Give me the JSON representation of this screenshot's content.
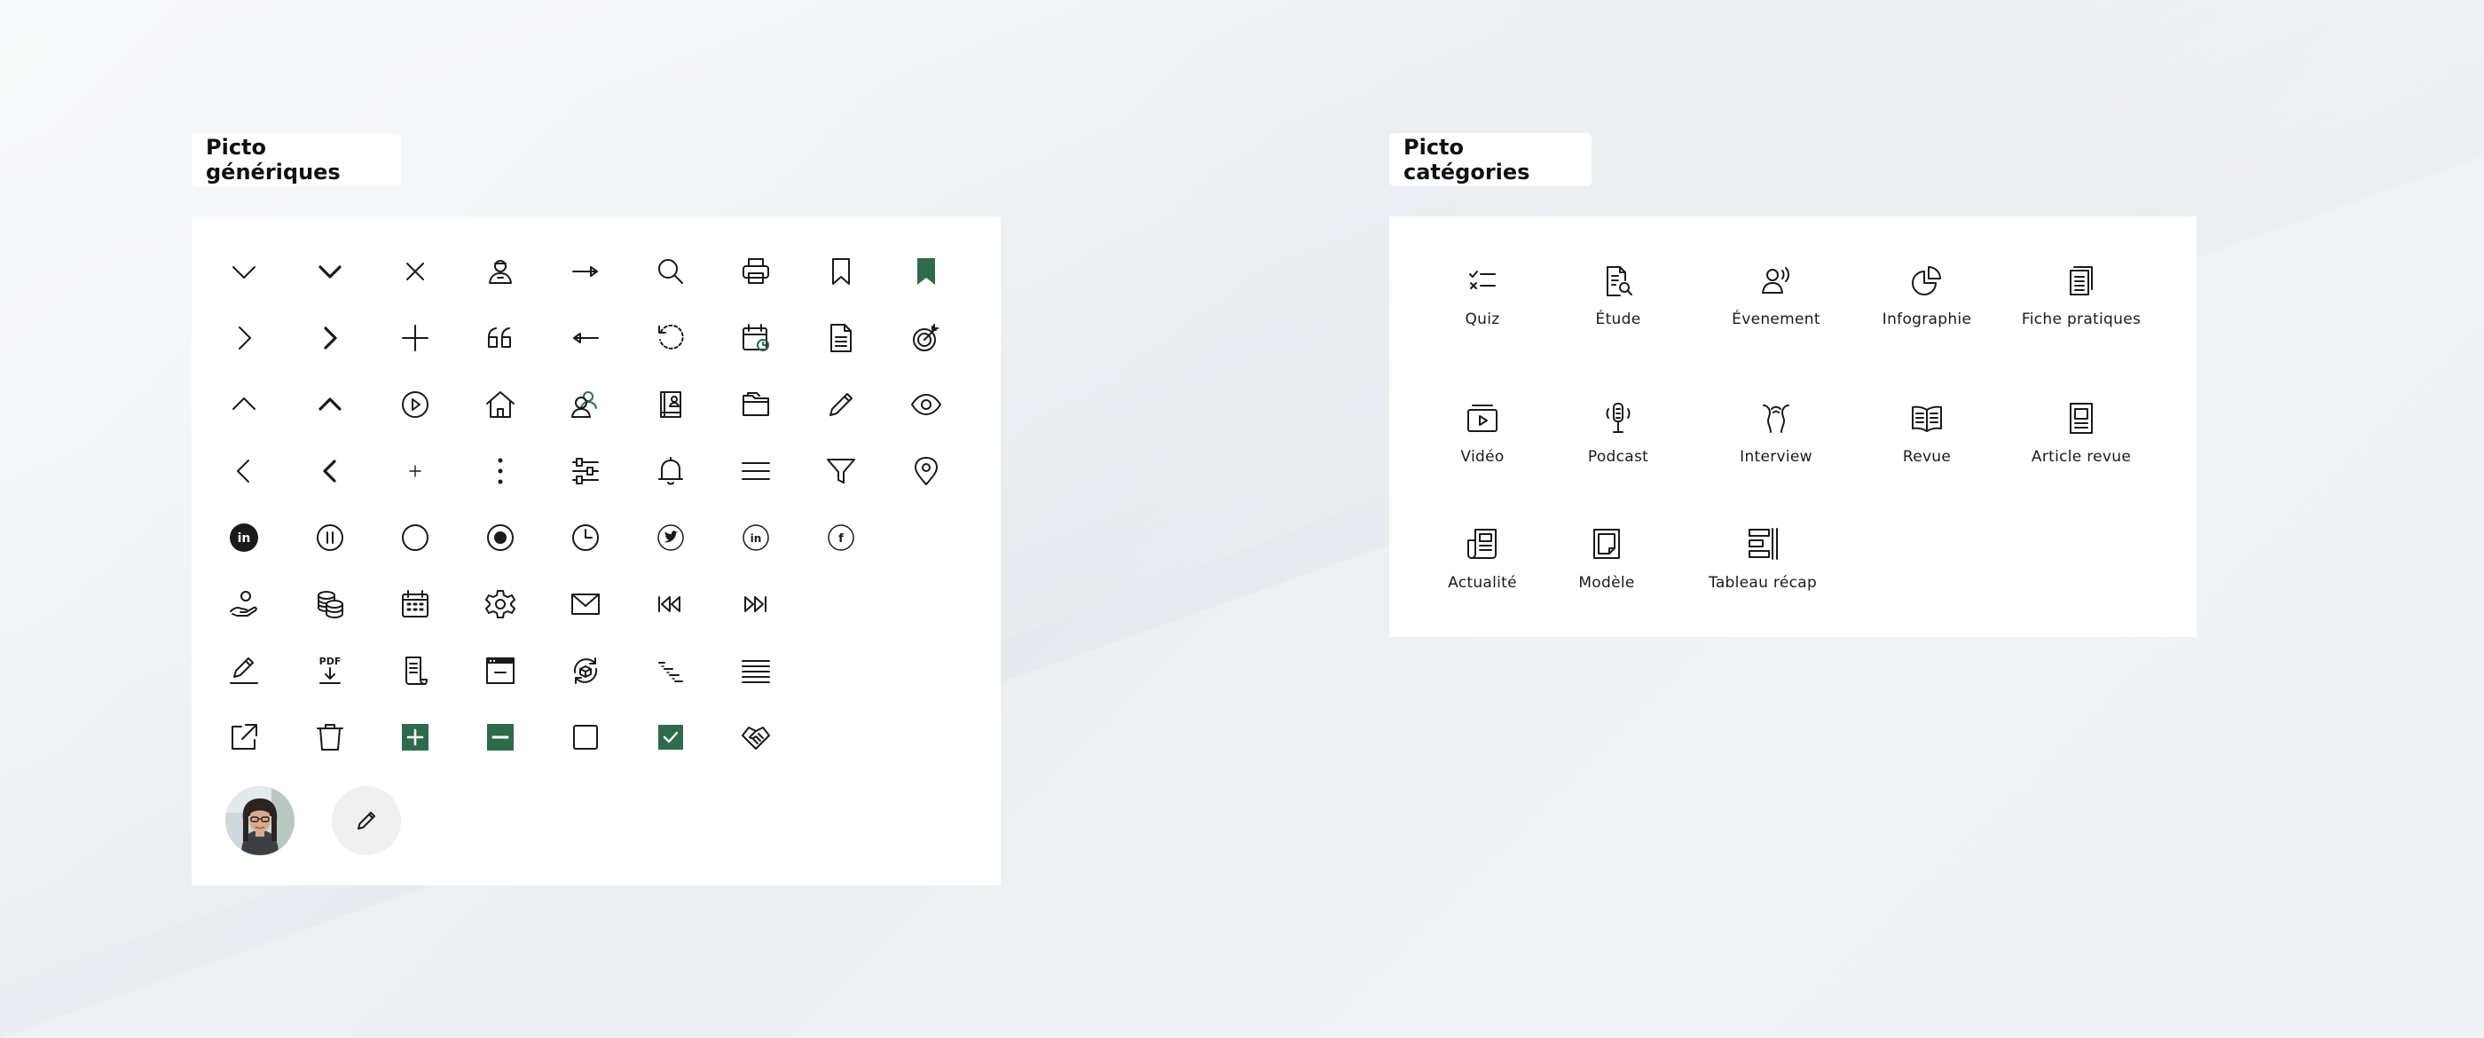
{
  "generic_section": {
    "title": "Picto génériques",
    "rows": [
      [
        "chevron-down-thin-icon",
        "chevron-down-bold-icon",
        "close-icon",
        "user-badge-icon",
        "arrow-right-icon",
        "search-icon",
        "printer-icon",
        "bookmark-outline-icon",
        "bookmark-filled-icon"
      ],
      [
        "chevron-right-thin-icon",
        "chevron-right-bold-icon",
        "plus-icon",
        "quote-icon",
        "arrow-left-icon",
        "refresh-icon",
        "calendar-clock-icon",
        "document-icon",
        "target-icon"
      ],
      [
        "chevron-up-thin-icon",
        "chevron-up-bold-icon",
        "play-circle-icon",
        "home-icon",
        "users-icon",
        "profile-card-icon",
        "folder-icon",
        "pencil-icon",
        "eye-icon"
      ],
      [
        "chevron-left-thin-icon",
        "chevron-left-bold-icon",
        "plus-small-icon",
        "more-vertical-icon",
        "sliders-icon",
        "bell-icon",
        "menu-icon",
        "filter-icon",
        "location-pin-icon"
      ],
      [
        "linkedin-filled-icon",
        "pause-circle-icon",
        "circle-outline-icon",
        "radio-checked-icon",
        "clock-icon",
        "twitter-circle-icon",
        "linkedin-circle-icon",
        "facebook-circle-icon"
      ],
      [
        "hand-coin-icon",
        "coins-stack-icon",
        "calendar-grid-icon",
        "gear-icon",
        "mail-icon",
        "rewind-icon",
        "fast-forward-icon"
      ],
      [
        "edit-underline-icon",
        "pdf-download-icon",
        "receipt-icon",
        "browser-window-icon",
        "box-cycle-icon",
        "indent-list-icon",
        "align-justify-icon"
      ],
      [
        "external-link-icon",
        "trash-icon",
        "checkbox-plus-icon",
        "checkbox-minus-icon",
        "checkbox-empty-icon",
        "checkbox-checked-icon",
        "handshake-icon"
      ]
    ],
    "extra": [
      "avatar",
      "edit-button"
    ],
    "accent_color": "#2e6b4a"
  },
  "categories_section": {
    "title": "Picto catégories",
    "items": [
      {
        "label": "Quiz",
        "icon": "quiz-icon"
      },
      {
        "label": "Étude",
        "icon": "study-icon"
      },
      {
        "label": "Évenement",
        "icon": "event-icon"
      },
      {
        "label": "Infographie",
        "icon": "infographic-icon"
      },
      {
        "label": "Fiche pratiques",
        "icon": "practical-sheet-icon"
      },
      {
        "label": "Vidéo",
        "icon": "video-icon"
      },
      {
        "label": "Podcast",
        "icon": "podcast-icon"
      },
      {
        "label": "Interview",
        "icon": "interview-icon"
      },
      {
        "label": "Revue",
        "icon": "review-icon"
      },
      {
        "label": "Article revue",
        "icon": "article-review-icon"
      },
      {
        "label": "Actualité",
        "icon": "news-icon"
      },
      {
        "label": "Modèle",
        "icon": "template-icon"
      },
      {
        "label": "Tableau récap",
        "icon": "summary-table-icon"
      }
    ]
  }
}
